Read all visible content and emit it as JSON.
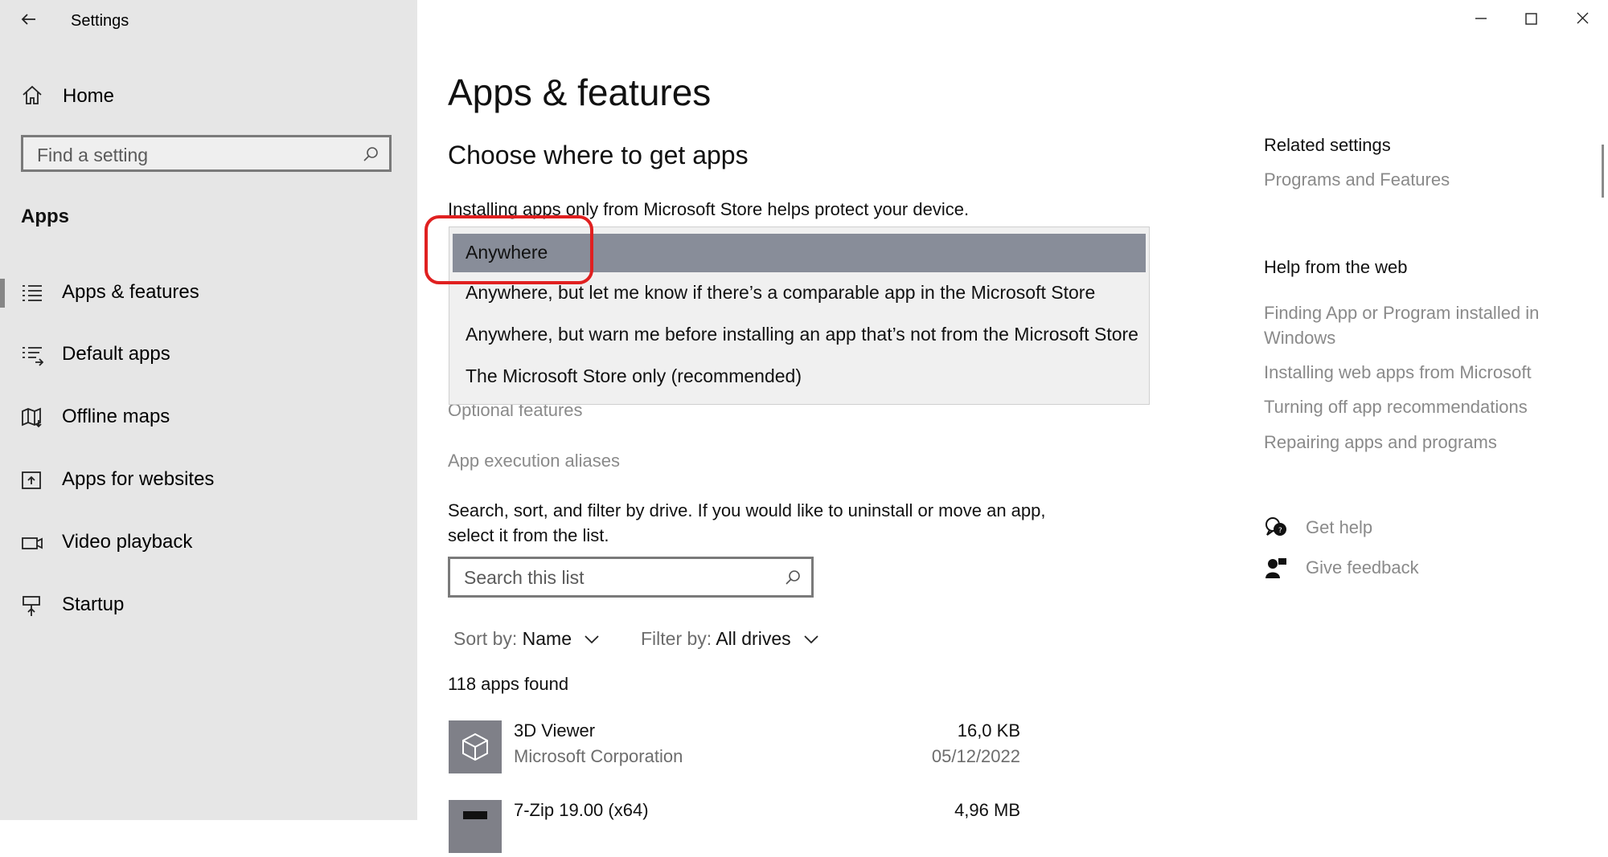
{
  "window": {
    "title": "Settings"
  },
  "sidebar": {
    "home_label": "Home",
    "search_placeholder": "Find a setting",
    "section_title": "Apps",
    "items": [
      {
        "label": "Apps & features",
        "icon": "list-icon",
        "selected": true
      },
      {
        "label": "Default apps",
        "icon": "default-apps-icon",
        "selected": false
      },
      {
        "label": "Offline maps",
        "icon": "map-icon",
        "selected": false
      },
      {
        "label": "Apps for websites",
        "icon": "apps-for-websites-icon",
        "selected": false
      },
      {
        "label": "Video playback",
        "icon": "video-icon",
        "selected": false
      },
      {
        "label": "Startup",
        "icon": "startup-icon",
        "selected": false
      }
    ]
  },
  "main": {
    "title": "Apps & features",
    "subheading": "Choose where to get apps",
    "description": "Installing apps only from Microsoft Store helps protect your device.",
    "dropdown": {
      "selected": "Anywhere",
      "options": [
        "Anywhere",
        "Anywhere, but let me know if there’s a comparable app in the Microsoft Store",
        "Anywhere, but warn me before installing an app that’s not from the Microsoft Store",
        "The Microsoft Store only (recommended)"
      ]
    },
    "optional_features_link": "Optional features",
    "app_execution_aliases_link": "App execution aliases",
    "search_description": "Search, sort, and filter by drive. If you would like to uninstall or move an app, select it from the list.",
    "search_placeholder": "Search this list",
    "sort": {
      "label": "Sort by:",
      "value": "Name"
    },
    "filter": {
      "label": "Filter by:",
      "value": "All drives"
    },
    "apps_found": "118 apps found",
    "apps": [
      {
        "name": "3D Viewer",
        "publisher": "Microsoft Corporation",
        "size": "16,0 KB",
        "date": "05/12/2022"
      },
      {
        "name": "7-Zip 19.00 (x64)",
        "publisher": "",
        "size": "4,96 MB",
        "date": ""
      }
    ]
  },
  "right": {
    "related_heading": "Related settings",
    "related_links": [
      "Programs and Features"
    ],
    "help_heading": "Help from the web",
    "help_links": [
      "Finding App or Program installed in Windows",
      "Installing web apps from Microsoft",
      "Turning off app recommendations",
      "Repairing apps and programs"
    ],
    "get_help": "Get help",
    "give_feedback": "Give feedback"
  },
  "colors": {
    "sidebar_bg": "#e6e6e6",
    "selected_option_bg": "#888d99",
    "highlight_red": "#e02020",
    "link_gray": "#8a8a8a"
  }
}
